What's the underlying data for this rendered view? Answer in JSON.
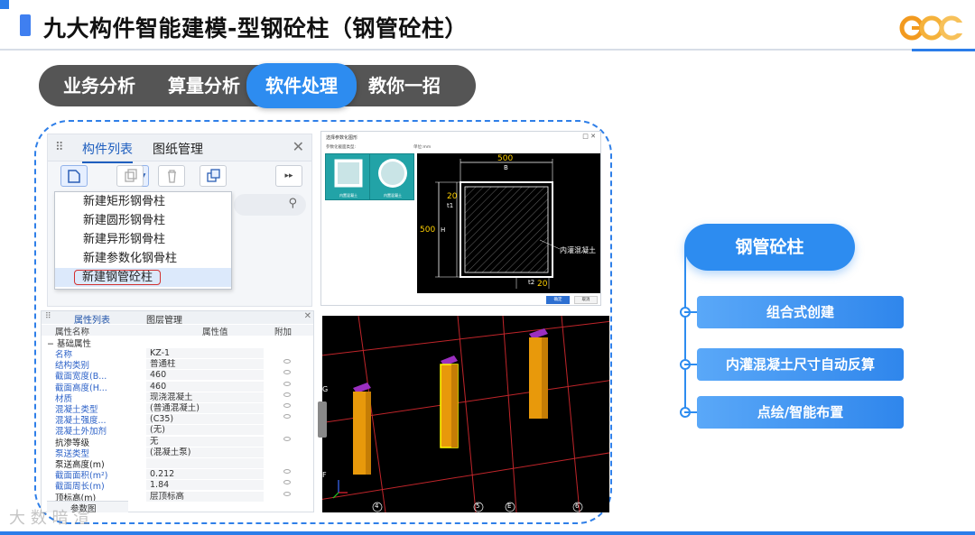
{
  "header": {
    "title": "九大构件智能建模-型钢砼柱（钢管砼柱）",
    "logo_text": "GCC",
    "accent_color": "#2b7de9"
  },
  "nav_tabs": [
    {
      "label": "业务分析",
      "active": false
    },
    {
      "label": "算量分析",
      "active": false
    },
    {
      "label": "软件处理",
      "active": true
    },
    {
      "label": "教你一招",
      "active": false
    }
  ],
  "component_panel": {
    "tabs": [
      "构件列表",
      "图纸管理"
    ],
    "new_menu": [
      "新建矩形钢骨柱",
      "新建圆形钢骨柱",
      "新建异形钢骨柱",
      "新建参数化钢骨柱",
      "新建钢管砼柱"
    ],
    "selected_menu_index": 4
  },
  "dialog": {
    "title": "选择参数化图形",
    "subtitle": "参数化截面类型:",
    "unit_label": "单位:mm",
    "thumbnails": [
      "内置混凝土",
      "内置混凝土"
    ],
    "drawing": {
      "dim_width": "500",
      "dim_width_label": "B",
      "dim_height": "500",
      "dim_height_label": "H",
      "dim_t1": "20",
      "dim_t1_label": "t1",
      "dim_t2": "20",
      "dim_t2_label": "t2",
      "annotation": "内灌混凝土"
    },
    "ok_label": "确定",
    "cancel_label": "取消"
  },
  "properties": {
    "tabs": [
      "属性列表",
      "图层管理"
    ],
    "headers": [
      "属性名称",
      "属性值",
      "附加"
    ],
    "group": "基础属性",
    "rows": [
      {
        "name": "名称",
        "value": "KZ-1",
        "style": "blue",
        "addon": false
      },
      {
        "name": "结构类别",
        "value": "普通柱",
        "style": "blue",
        "addon": true
      },
      {
        "name": "截面宽度(B...",
        "value": "460",
        "style": "blue",
        "addon": true
      },
      {
        "name": "截面高度(H...",
        "value": "460",
        "style": "blue",
        "addon": true
      },
      {
        "name": "材质",
        "value": "现浇混凝土",
        "style": "blue",
        "addon": true
      },
      {
        "name": "混凝土类型",
        "value": "(普通混凝土)",
        "style": "blue",
        "addon": true
      },
      {
        "name": "混凝土强度...",
        "value": "(C35)",
        "style": "blue",
        "addon": true
      },
      {
        "name": "混凝土外加剂",
        "value": "(无)",
        "style": "blue",
        "addon": false
      },
      {
        "name": "抗渗等级",
        "value": "无",
        "style": "dark",
        "addon": true
      },
      {
        "name": "泵送类型",
        "value": "(混凝土泵)",
        "style": "blue",
        "addon": false
      },
      {
        "name": "泵送高度(m)",
        "value": "",
        "style": "dark",
        "addon": false
      },
      {
        "name": "截面面积(m²)",
        "value": "0.212",
        "style": "blue",
        "addon": true
      },
      {
        "name": "截面周长(m)",
        "value": "1.84",
        "style": "blue",
        "addon": true
      },
      {
        "name": "顶标高(m)",
        "value": "层顶标高",
        "style": "dark",
        "addon": true
      }
    ],
    "footer_tab": "参数图"
  },
  "view3d": {
    "axis_labels": [
      "G",
      "F",
      "4",
      "5",
      "E",
      "6"
    ]
  },
  "feature_diagram": {
    "hub_label": "钢管砼柱",
    "items": [
      "组合式创建",
      "内灌混凝土尺寸自动反算",
      "点绘/智能布置"
    ]
  },
  "watermark": "大 数 暗 渲"
}
